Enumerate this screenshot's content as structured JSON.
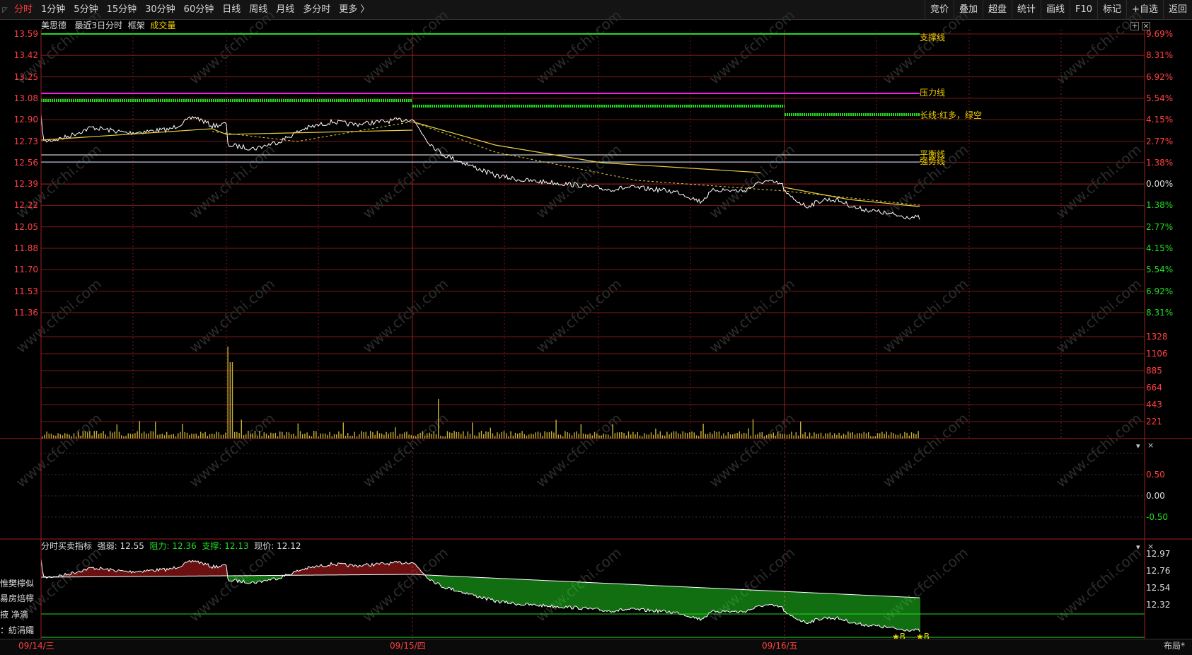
{
  "toolbar": {
    "left": [
      {
        "label": "分时",
        "active": true
      },
      {
        "label": "1分钟"
      },
      {
        "label": "5分钟"
      },
      {
        "label": "15分钟"
      },
      {
        "label": "30分钟"
      },
      {
        "label": "60分钟"
      },
      {
        "label": "日线"
      },
      {
        "label": "周线"
      },
      {
        "label": "月线"
      },
      {
        "label": "多分时"
      },
      {
        "label": "更多 〉"
      }
    ],
    "right": [
      "竞价",
      "叠加",
      "超盘",
      "统计",
      "画线",
      "F10",
      "标记",
      "+自选",
      "返回"
    ]
  },
  "chart_header": {
    "stock": "美思德",
    "period": "最近3日分时",
    "mode": "框架",
    "indicator": "成交量"
  },
  "price_axis": [
    "13.59",
    "13.42",
    "13.25",
    "13.08",
    "12.90",
    "12.73",
    "12.56",
    "12.39",
    "12.22",
    "12.05",
    "11.88",
    "11.70",
    "11.53",
    "11.36"
  ],
  "pct_axis": [
    "9.69%",
    "8.31%",
    "6.92%",
    "5.54%",
    "4.15%",
    "2.77%",
    "1.38%",
    "0.00%",
    "1.38%",
    "2.77%",
    "4.15%",
    "5.54%",
    "6.92%",
    "8.31%"
  ],
  "volume_axis": [
    "1328",
    "1106",
    "885",
    "664",
    "443",
    "221"
  ],
  "mid_axis": [
    "0.50",
    "0.00",
    "-0.50"
  ],
  "bottom_axis": [
    "12.97",
    "12.76",
    "12.54",
    "12.32"
  ],
  "line_labels": {
    "support": "支撑线",
    "pressure": "压力线",
    "long": "长线:红多，绿空",
    "balance": "平衡线",
    "strong": "强势线"
  },
  "bottom_header": {
    "name": "分时买卖指标",
    "strong_label": "强弱:",
    "strong_val": "12.55",
    "resist_label": "阻力:",
    "resist_val": "12.36",
    "support_label": "支撑:",
    "support_val": "12.13",
    "price_label": "现价:",
    "price_val": "12.12"
  },
  "side_labels": [
    "惟樊檸似",
    "昜房焙檸",
    "掖  净滴",
    "：紡涓孀"
  ],
  "dates": [
    "09/14/三",
    "09/15/四",
    "09/16/五"
  ],
  "marker_text": "B",
  "layout_btn": "布局*",
  "watermark": "www.cfchi.com",
  "colors": {
    "grid": "#7a1a1a",
    "price": "#ffffff",
    "avg": "#e8d040",
    "support": "#22dd22",
    "pressure": "#ee22ee",
    "volume": "#c8b030",
    "red_bar": "#d42020",
    "green_bar": "#22dd22"
  }
}
